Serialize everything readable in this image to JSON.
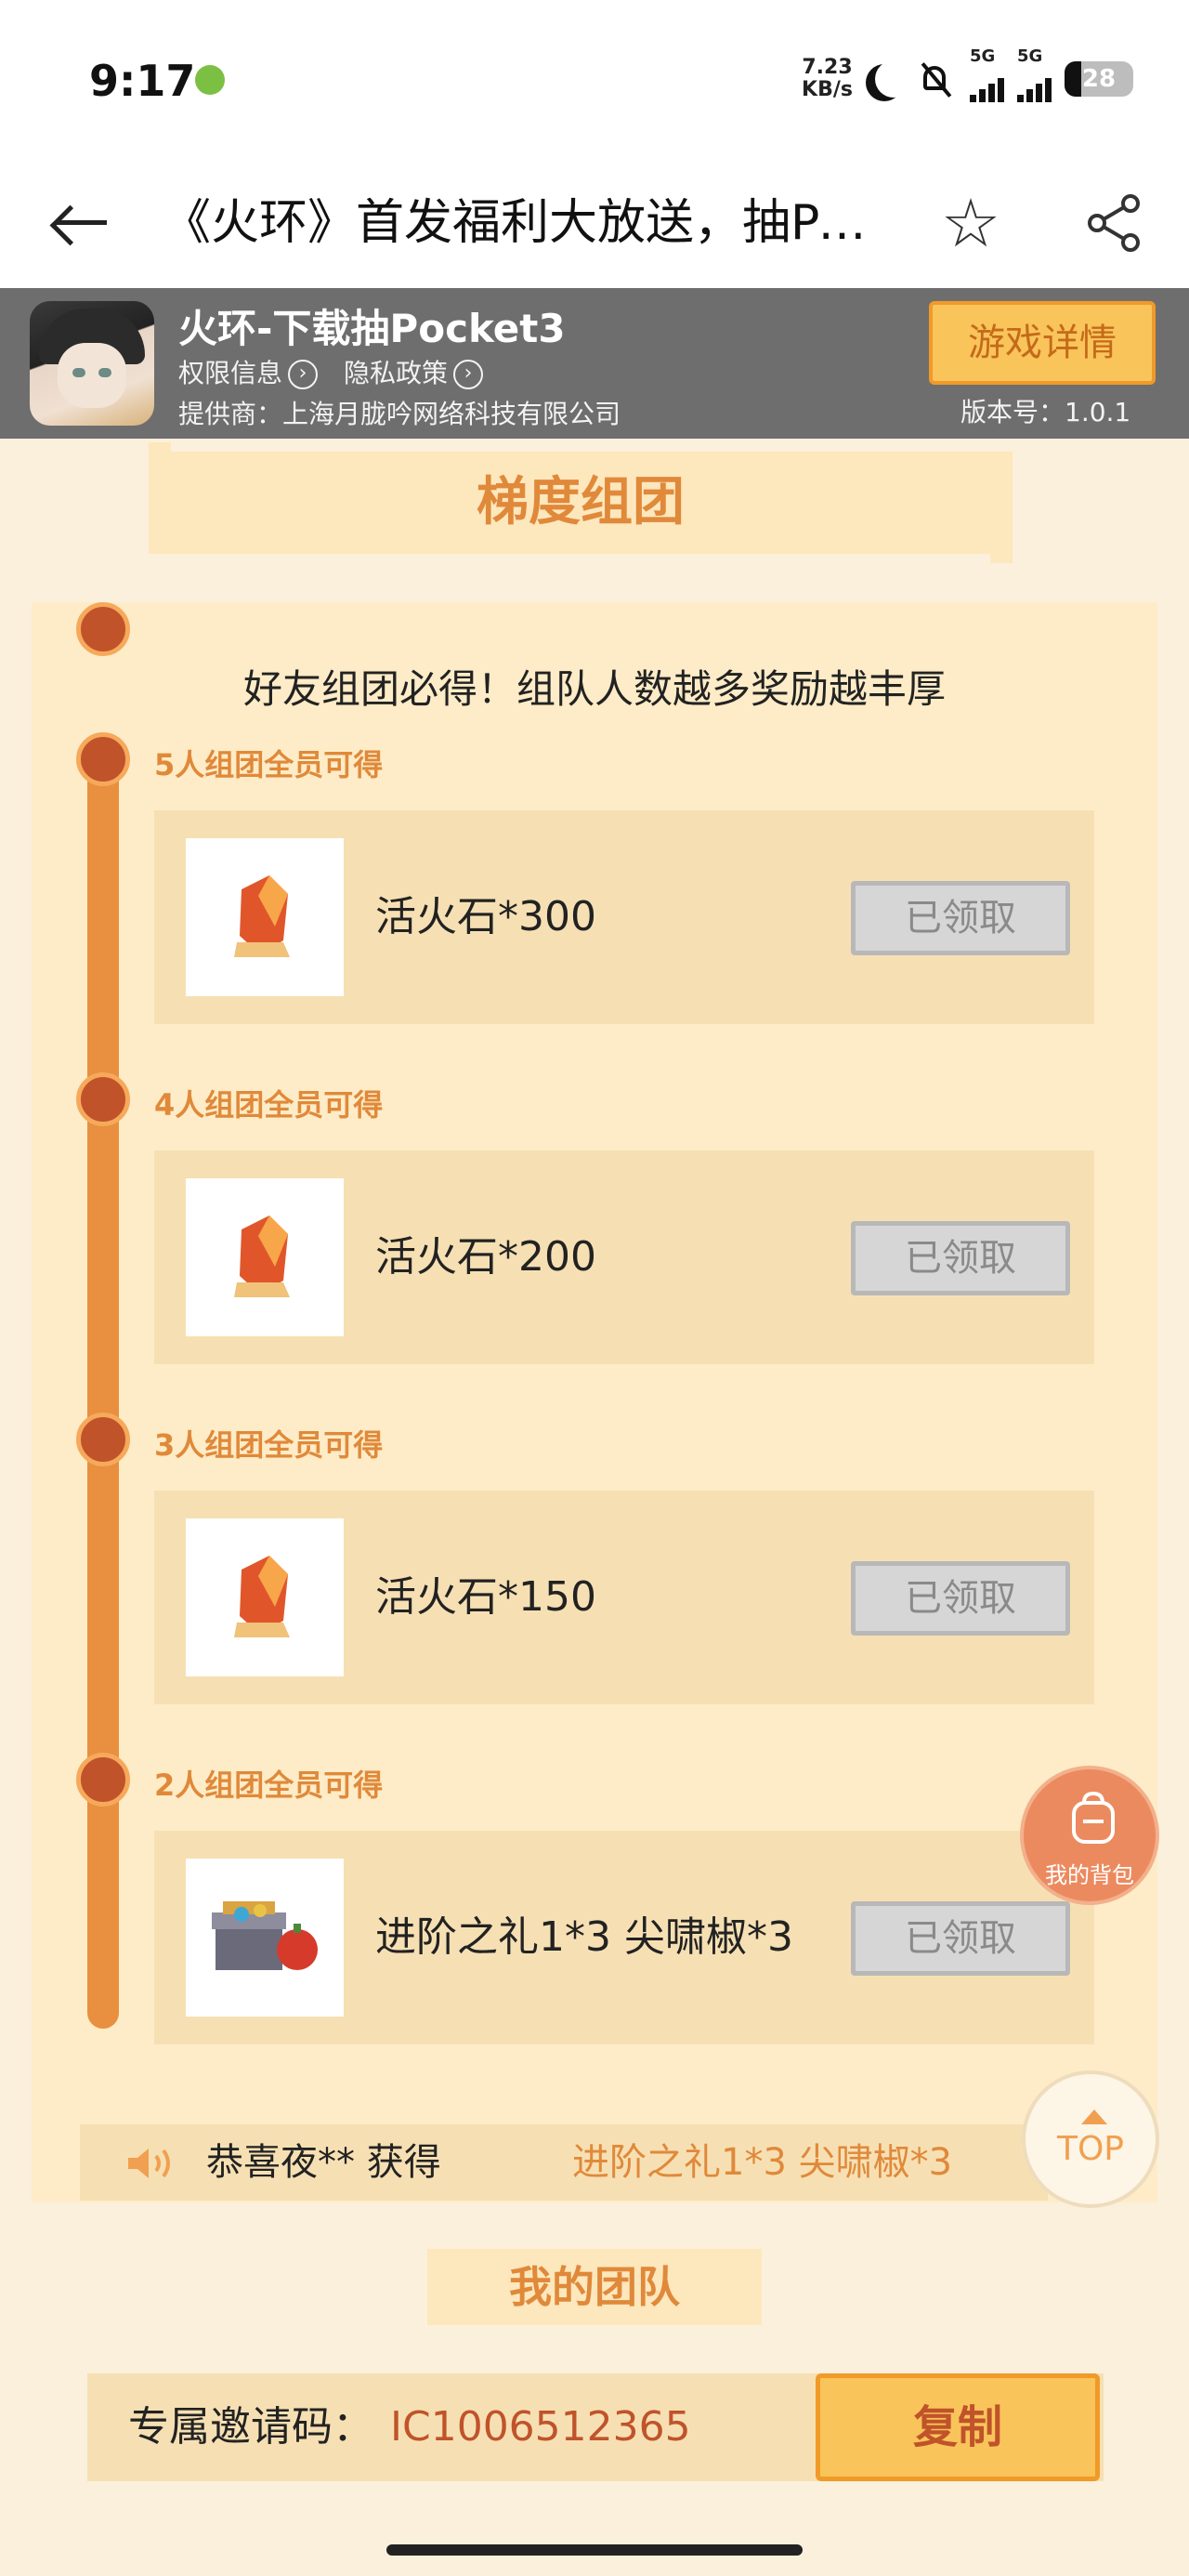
{
  "status_bar": {
    "time": "9:17",
    "net_speed_value": "7.23",
    "net_speed_unit": "KB/s",
    "signal1": "5G",
    "signal2": "5G",
    "battery": "28"
  },
  "nav": {
    "title": "《火环》首发福利大放送，抽Pocket3"
  },
  "game": {
    "name": "火环-下载抽Pocket3",
    "permission_link": "权限信息",
    "privacy_link": "隐私政策",
    "provider": "提供商：上海月胧吟网络科技有限公司",
    "detail_button": "游戏详情",
    "version": "版本号：1.0.1"
  },
  "section": {
    "title": "梯度组团",
    "subtitle": "好友组团必得！组队人数越多奖励越丰厚"
  },
  "tiers": [
    {
      "title": "5人组团全员可得",
      "reward": "活火石*300",
      "status": "已领取",
      "icon": "fire-stone-icon"
    },
    {
      "title": "4人组团全员可得",
      "reward": "活火石*200",
      "status": "已领取",
      "icon": "fire-stone-icon"
    },
    {
      "title": "3人组团全员可得",
      "reward": "活火石*150",
      "status": "已领取",
      "icon": "fire-stone-icon"
    },
    {
      "title": "2人组团全员可得",
      "reward": "进阶之礼1*3   尖啸椒*3",
      "status": "已领取",
      "icon": "gift-chest-icon"
    }
  ],
  "ticker": {
    "user_text": "恭喜夜**  获得",
    "prize_text": "进阶之礼1*3   尖啸椒*3"
  },
  "team": {
    "title": "我的团队",
    "invite_label": "专属邀请码：",
    "invite_code": "IC1006512365",
    "copy_button": "复制"
  },
  "floating": {
    "bag_label": "我的背包",
    "top_label": "TOP"
  }
}
